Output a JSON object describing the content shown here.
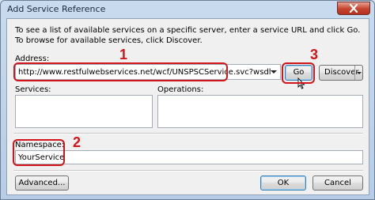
{
  "window": {
    "title": "Add Service Reference"
  },
  "intro": "To see a list of available services on a specific server, enter a service URL and click Go. To browse for available services, click Discover.",
  "address": {
    "label": "Address:",
    "value": "http://www.restfulwebservices.net/wcf/UNSPSCService.svc?wsdl"
  },
  "buttons": {
    "go": "Go",
    "discover": "Discover",
    "advanced": "Advanced...",
    "ok": "OK",
    "cancel": "Cancel"
  },
  "services": {
    "label": "Services:"
  },
  "operations": {
    "label": "Operations:"
  },
  "namespace": {
    "label": "Namespace:",
    "value": "YourService"
  },
  "annotations": {
    "one": "1",
    "two": "2",
    "three": "3"
  },
  "colors": {
    "annotation": "#d3141a",
    "close_button": "#c7422c",
    "window_frame": "#b7cce6"
  },
  "icons": [
    "close-icon",
    "mouse-cursor-icon"
  ]
}
